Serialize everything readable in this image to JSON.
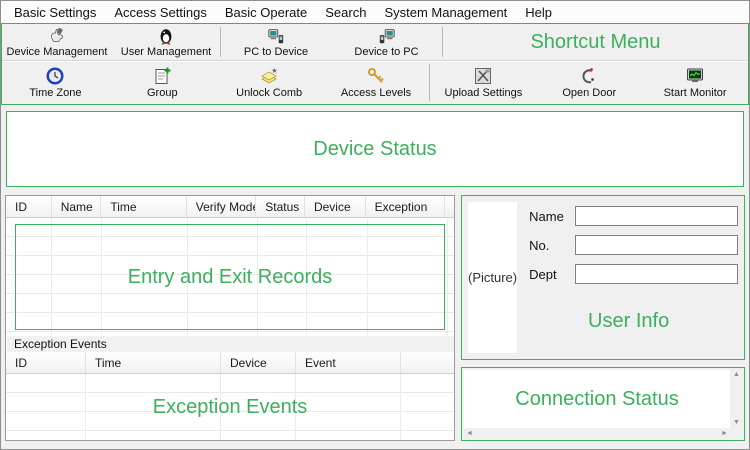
{
  "colors": {
    "accent_green": "#3cb05c",
    "window_bg": "#f0f0f0"
  },
  "menu": {
    "items": [
      "Basic Settings",
      "Access Settings",
      "Basic Operate",
      "Search",
      "System Management",
      "Help"
    ]
  },
  "toolbar": {
    "shortcut_label": "Shortcut Menu",
    "row1": [
      {
        "label": "Device Management",
        "icon": "device-management-icon"
      },
      {
        "label": "User Management",
        "icon": "user-management-icon"
      },
      {
        "label": "PC to Device",
        "icon": "pc-to-device-icon"
      },
      {
        "label": "Device to PC",
        "icon": "device-to-pc-icon"
      }
    ],
    "row2": [
      {
        "label": "Time Zone",
        "icon": "time-zone-icon"
      },
      {
        "label": "Group",
        "icon": "group-icon"
      },
      {
        "label": "Unlock Comb",
        "icon": "unlock-comb-icon"
      },
      {
        "label": "Access Levels",
        "icon": "access-levels-icon"
      },
      {
        "label": "Upload Settings",
        "icon": "upload-settings-icon"
      },
      {
        "label": "Open Door",
        "icon": "open-door-icon"
      },
      {
        "label": "Start Monitor",
        "icon": "start-monitor-icon"
      }
    ]
  },
  "device_status": {
    "overlay_label": "Device Status"
  },
  "records": {
    "columns": [
      "ID",
      "Name",
      "Time",
      "Verify Mode",
      "Status",
      "Device",
      "Exception"
    ],
    "rows": [],
    "overlay_label": "Entry and Exit Records"
  },
  "exception": {
    "group_label": "Exception Events",
    "columns": [
      "ID",
      "Time",
      "Device",
      "Event"
    ],
    "rows": [],
    "overlay_label": "Exception Events"
  },
  "user_info": {
    "picture_placeholder": "(Picture)",
    "overlay_label": "User Info",
    "fields": [
      {
        "label": "Name",
        "value": ""
      },
      {
        "label": "No.",
        "value": ""
      },
      {
        "label": "Dept",
        "value": ""
      }
    ]
  },
  "connection": {
    "overlay_label": "Connection Status",
    "scrollbar": {
      "up": "▲",
      "down": "▼",
      "left": "◄",
      "right": "►"
    }
  }
}
